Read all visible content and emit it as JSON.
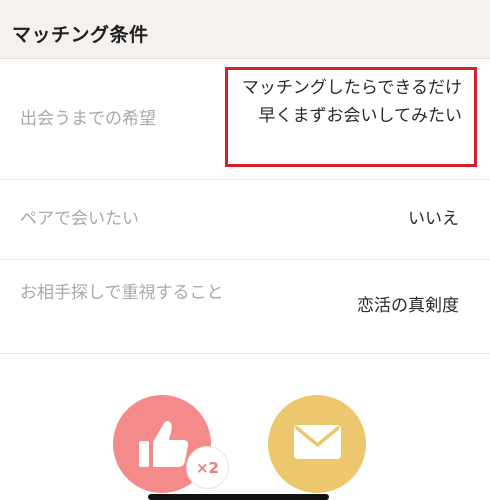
{
  "section": {
    "title": "マッチング条件"
  },
  "rows": [
    {
      "label": "出会うまでの希望",
      "value": "マッチングしたらできるだけ早くまずお会いしてみたい"
    },
    {
      "label": "ペアで会いたい",
      "value": "いいえ"
    },
    {
      "label": "お相手探しで重視すること",
      "value": "恋活の真剣度"
    }
  ],
  "actions": {
    "like_multiplier": "×2"
  },
  "icons": {
    "like": "thumbs-up-icon",
    "message": "envelope-icon"
  },
  "colors": {
    "highlight": "#d3222b",
    "like_button": "#f48a8a",
    "message_button": "#ecc76e"
  }
}
